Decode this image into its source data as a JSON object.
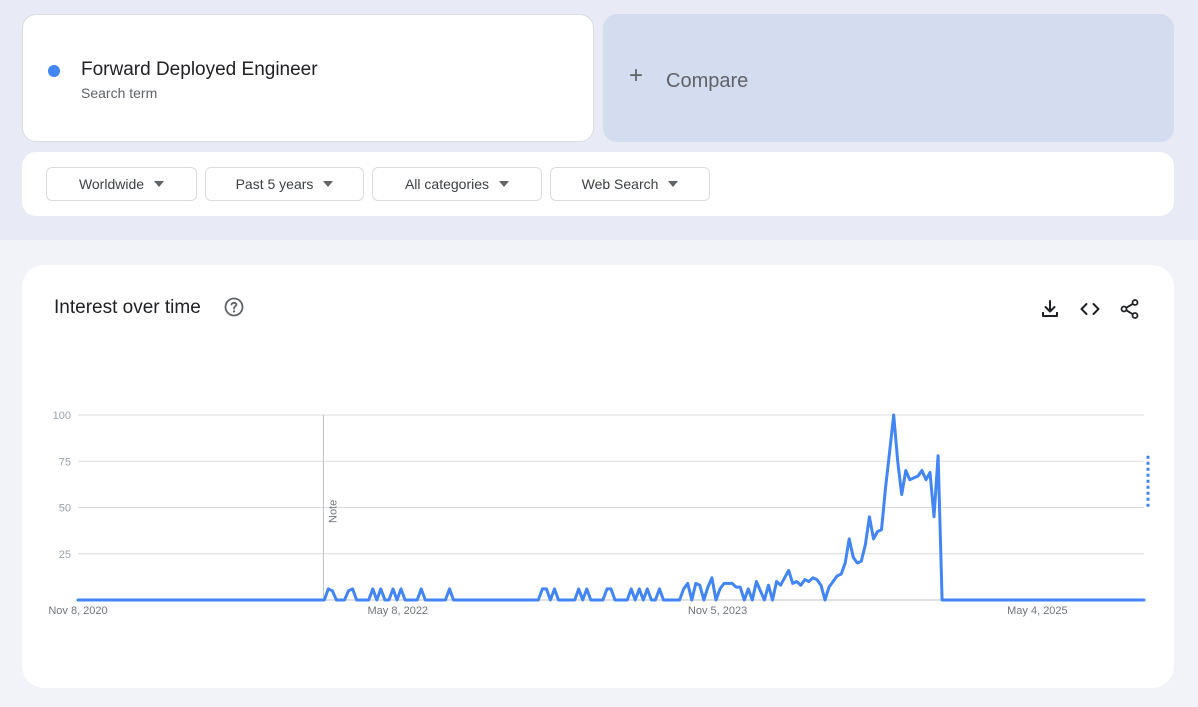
{
  "search_term": {
    "title": "Forward Deployed Engineer",
    "subtitle": "Search term",
    "color": "#4285f4"
  },
  "compare": {
    "label": "Compare",
    "icon": "plus-icon"
  },
  "filters": {
    "region": "Worldwide",
    "time_range": "Past 5 years",
    "category": "All categories",
    "search_type": "Web Search"
  },
  "chart_card": {
    "title": "Interest over time",
    "help_icon": "help-icon",
    "tools": [
      "download-icon",
      "embed-icon",
      "share-icon"
    ]
  },
  "chart_data": {
    "type": "line",
    "title": "Interest over time",
    "xlabel": "",
    "ylabel": "",
    "ylim": [
      0,
      100
    ],
    "y_ticks": [
      100,
      75,
      50,
      25
    ],
    "x_tick_labels": [
      "Nov 8, 2020",
      "May 8, 2022",
      "Nov 5, 2023",
      "May 4, 2025"
    ],
    "x_start": "Nov 8, 2020",
    "x_end": "Nov 2, 2025",
    "note_date": "Jan 1, 2022",
    "note_label": "Note",
    "line_color": "#4285f4",
    "grid": true,
    "series": [
      {
        "values": [
          0,
          0,
          0,
          0,
          0,
          0,
          0,
          0,
          0,
          0,
          0,
          0,
          0,
          0,
          0,
          0,
          0,
          0,
          0,
          0,
          0,
          0,
          0,
          0,
          0,
          0,
          0,
          0,
          0,
          0,
          0,
          0,
          0,
          0,
          0,
          0,
          0,
          0,
          0,
          0,
          0,
          0,
          0,
          0,
          0,
          0,
          0,
          0,
          0,
          0,
          0,
          0,
          0,
          0,
          0,
          0,
          0,
          0,
          0,
          0,
          0,
          0,
          0,
          0,
          0,
          0,
          0,
          0,
          0,
          0,
          0,
          0,
          0,
          0,
          0,
          0,
          0,
          0,
          0,
          0,
          0,
          0,
          0,
          0,
          0,
          0,
          0,
          0,
          0,
          0,
          0,
          0,
          0,
          0,
          0,
          0,
          0,
          0,
          0,
          0,
          0,
          0,
          0,
          0,
          0,
          0,
          0,
          0,
          0,
          0,
          0,
          0,
          0,
          0,
          0,
          0,
          0,
          0,
          0,
          0,
          0,
          0,
          0,
          0,
          0,
          0,
          0,
          0,
          0,
          0,
          0,
          0,
          0,
          0,
          0,
          0,
          0,
          0,
          0,
          0,
          0,
          0,
          0,
          0,
          0,
          0,
          0,
          0,
          0,
          0,
          0,
          0,
          0,
          0,
          0,
          0,
          0,
          0,
          0,
          0,
          0,
          0,
          0,
          0,
          0,
          0,
          0,
          0,
          0,
          0,
          0,
          0,
          0,
          0,
          0,
          0,
          0,
          0,
          0,
          0,
          0,
          0,
          0,
          0,
          0,
          0,
          0,
          0,
          0,
          0,
          0,
          0,
          0,
          0,
          0,
          0,
          0,
          0,
          0,
          0,
          0,
          0,
          0,
          0,
          0,
          0,
          0,
          0,
          0,
          0,
          0,
          0,
          0,
          0,
          0,
          0,
          0,
          0,
          0,
          0,
          0,
          0,
          0,
          0,
          0,
          0,
          0,
          0,
          0,
          0,
          0,
          0,
          0,
          0,
          0,
          0,
          0,
          0,
          0,
          0,
          0,
          0,
          0,
          0,
          0,
          0,
          0,
          0,
          0,
          0,
          0,
          0,
          0,
          0,
          0,
          0,
          0,
          0,
          0,
          0,
          0,
          0,
          0,
          0,
          0
        ],
        "overrides": {
          "62": 6,
          "63": 5,
          "67": 5,
          "68": 6,
          "73": 6,
          "75": 6,
          "78": 6,
          "80": 6,
          "85": 6,
          "92": 6,
          "115": 6,
          "116": 6,
          "118": 6,
          "124": 6,
          "126": 6,
          "131": 6,
          "132": 6,
          "137": 6,
          "139": 6,
          "141": 6,
          "144": 6,
          "150": 6,
          "151": 9,
          "153": 9,
          "154": 8,
          "156": 7,
          "157": 12,
          "159": 6,
          "160": 9,
          "161": 9,
          "162": 9,
          "163": 7,
          "164": 7,
          "166": 6,
          "168": 10,
          "169": 5,
          "171": 8,
          "173": 10,
          "174": 8,
          "175": 12,
          "176": 16,
          "177": 9,
          "178": 10,
          "179": 8,
          "180": 11,
          "181": 10,
          "182": 12,
          "183": 11,
          "184": 8,
          "185": 0,
          "186": 7,
          "187": 10,
          "188": 13,
          "189": 14,
          "190": 20,
          "191": 33,
          "192": 23,
          "193": 20,
          "194": 21,
          "195": 30,
          "196": 45,
          "197": 33,
          "198": 37,
          "199": 38,
          "200": 61,
          "201": 80,
          "202": 100,
          "203": 75,
          "204": 57,
          "205": 70,
          "206": 65,
          "207": 66,
          "208": 67,
          "209": 70,
          "210": 65,
          "211": 69,
          "212": 45,
          "213": 78
        },
        "partial_last": [
          78,
          50
        ]
      }
    ]
  }
}
